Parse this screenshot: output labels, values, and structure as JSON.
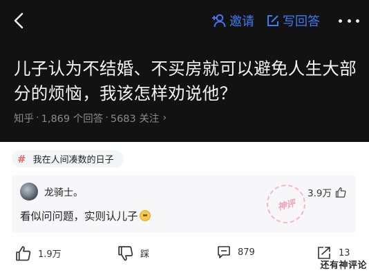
{
  "header": {
    "back_icon": "chevron-left-icon",
    "invite_label": "邀请",
    "write_answer_label": "写回答",
    "more_icon": "more-dots-icon",
    "accent_color": "#3f7bf5"
  },
  "question": {
    "title": "儿子认为不结婚、不买房就可以避免人生大部分的烦恼，我该怎样劝说他？",
    "source": "知乎",
    "answer_count": "1,869 个回答",
    "follower_count": "5683 关注",
    "separator": "·",
    "arrow": "›"
  },
  "topic": {
    "label": "我在人间凑数的日子",
    "icon": "#"
  },
  "answer": {
    "author": "龙骑士。",
    "likes": "3.9万",
    "text": "看似问问题，实则认儿子",
    "stamp_text": "神评"
  },
  "actions": {
    "upvote": "1.9万",
    "downvote": "踩",
    "comments": "879",
    "share": "13"
  },
  "watermark": "还有神评论"
}
